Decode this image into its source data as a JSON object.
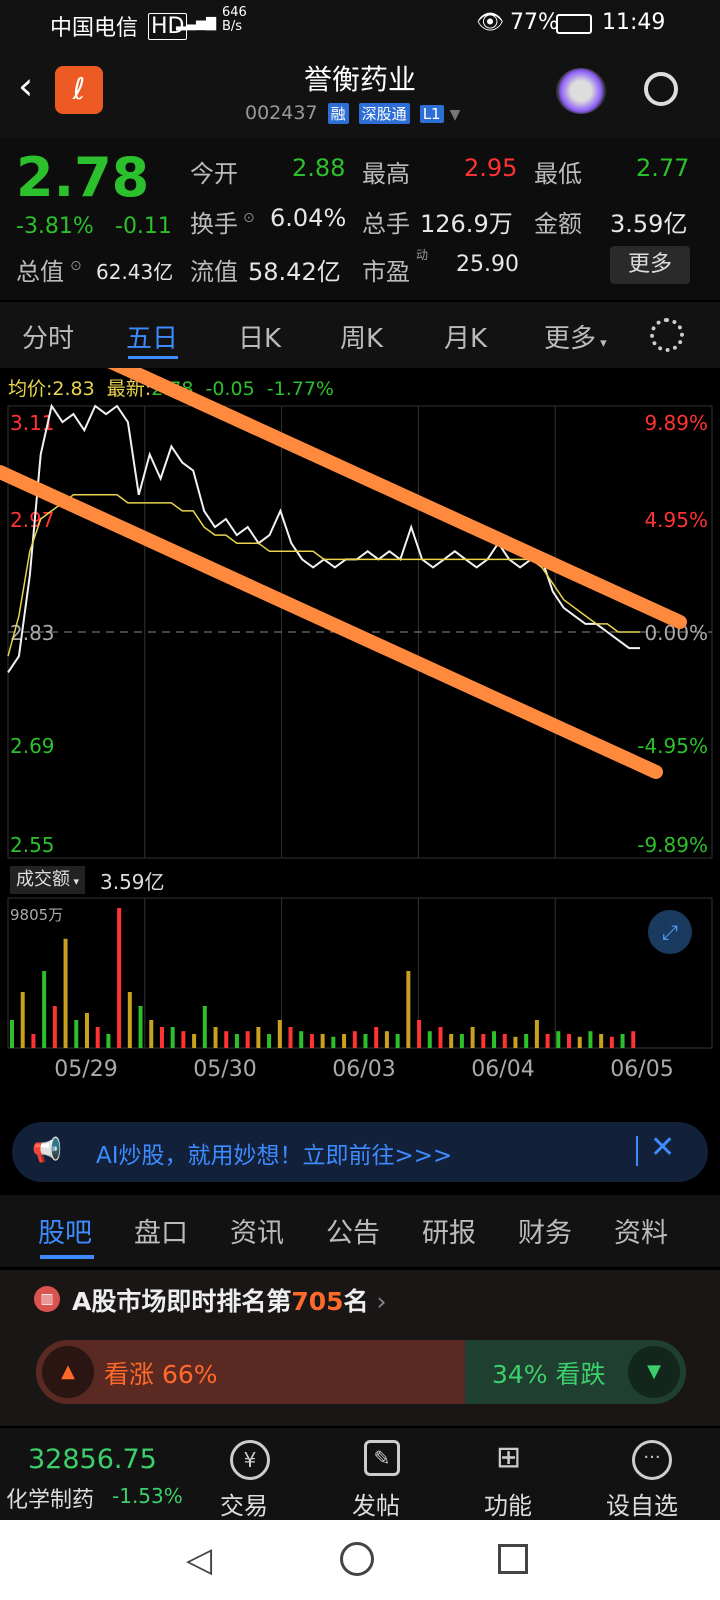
{
  "status_bar": {
    "carrier": "中国电信",
    "hd": "HD",
    "net_speed_value": "646",
    "net_speed_unit": "B/s",
    "battery": "77%",
    "time": "11:49"
  },
  "header": {
    "title": "誉衡药业",
    "code": "002437",
    "tags": [
      "融",
      "深股通",
      "L1"
    ]
  },
  "quote": {
    "price": "2.78",
    "change_pct": "-3.81%",
    "change": "-0.11",
    "open_label": "今开",
    "open": "2.88",
    "high_label": "最高",
    "high": "2.95",
    "low_label": "最低",
    "low": "2.77",
    "turnover_label": "换手",
    "turnover": "6.04%",
    "volume_label": "总手",
    "volume": "126.9万",
    "amount_label": "金额",
    "amount": "3.59亿",
    "mcap_label": "总值",
    "mcap": "62.43亿",
    "float_label": "流值",
    "float": "58.42亿",
    "pe_label": "市盈",
    "pe_sup": "动",
    "pe": "25.90",
    "more_label": "更多"
  },
  "chart_tabs": [
    "分时",
    "五日",
    "日K",
    "周K",
    "月K",
    "更多"
  ],
  "chart_tabs_active": 1,
  "chart_info": {
    "avg_label": "均价:",
    "avg": "2.83",
    "latest_label": "最新:",
    "latest": "2.78",
    "chg": "-0.05",
    "chg_pct": "-1.77%"
  },
  "chart_data": {
    "type": "line",
    "y_ticks_left": [
      "3.11",
      "2.97",
      "2.83",
      "2.69",
      "2.55"
    ],
    "y_ticks_right": [
      "9.89%",
      "4.95%",
      "0.00%",
      "-4.95%",
      "-9.89%"
    ],
    "ylim": [
      2.55,
      3.11
    ],
    "x_labels": [
      "05/29",
      "05/30",
      "06/03",
      "06/04",
      "06/05"
    ],
    "series": [
      {
        "values": [
          2.78,
          2.8,
          2.9,
          3.05,
          3.11,
          3.09,
          3.1,
          3.08,
          3.11,
          3.1,
          3.11,
          3.09,
          3.0,
          3.05,
          3.02,
          3.06,
          3.04,
          3.03,
          2.98,
          2.96,
          2.97,
          2.95,
          2.96,
          2.94,
          2.95,
          2.98,
          2.94,
          2.92,
          2.91,
          2.92,
          2.91,
          2.92,
          2.92,
          2.93,
          2.92,
          2.93,
          2.92,
          2.96,
          2.92,
          2.91,
          2.92,
          2.93,
          2.92,
          2.91,
          2.92,
          2.94,
          2.92,
          2.91,
          2.92,
          2.92,
          2.88,
          2.86,
          2.85,
          2.84,
          2.84,
          2.83,
          2.82,
          2.81,
          2.81
        ]
      },
      {
        "values": [
          2.8,
          2.85,
          2.93,
          2.97,
          2.98,
          2.99,
          3.0,
          3.0,
          3.0,
          3.0,
          3.0,
          2.99,
          2.99,
          2.99,
          2.99,
          2.99,
          2.98,
          2.98,
          2.96,
          2.95,
          2.95,
          2.94,
          2.94,
          2.94,
          2.93,
          2.93,
          2.93,
          2.93,
          2.93,
          2.92,
          2.92,
          2.92,
          2.92,
          2.92,
          2.92,
          2.92,
          2.92,
          2.92,
          2.92,
          2.92,
          2.92,
          2.92,
          2.92,
          2.92,
          2.92,
          2.92,
          2.92,
          2.92,
          2.92,
          2.91,
          2.89,
          2.87,
          2.86,
          2.85,
          2.84,
          2.84,
          2.83,
          2.83,
          2.83
        ]
      }
    ],
    "volume_label": "成交额",
    "volume_total": "3.59亿",
    "volume_max": "9805万",
    "volume_values": [
      20,
      40,
      10,
      55,
      30,
      78,
      20,
      25,
      15,
      10,
      100,
      40,
      30,
      20,
      15,
      15,
      12,
      10,
      30,
      15,
      12,
      10,
      12,
      15,
      10,
      20,
      15,
      12,
      10,
      10,
      8,
      10,
      12,
      10,
      15,
      12,
      10,
      55,
      20,
      12,
      15,
      10,
      10,
      15,
      10,
      12,
      10,
      8,
      10,
      20,
      10,
      12,
      10,
      8,
      12,
      10,
      8,
      10,
      12
    ]
  },
  "ad": {
    "text": "AI炒股，就用妙想！立即前往>>>"
  },
  "bottom_tabs": [
    "股吧",
    "盘口",
    "资讯",
    "公告",
    "研报",
    "财务",
    "资料"
  ],
  "bottom_tabs_active": 0,
  "rank": {
    "prefix": "A股市场即时排名第",
    "rank": "705",
    "suffix": "名",
    "bull": "看涨 66%",
    "bear": "34% 看跌"
  },
  "nav": {
    "index_value": "32856.75",
    "index_name": "化学制药",
    "index_chg": "-1.53%",
    "items": [
      "交易",
      "发帖",
      "功能",
      "设自选"
    ]
  }
}
